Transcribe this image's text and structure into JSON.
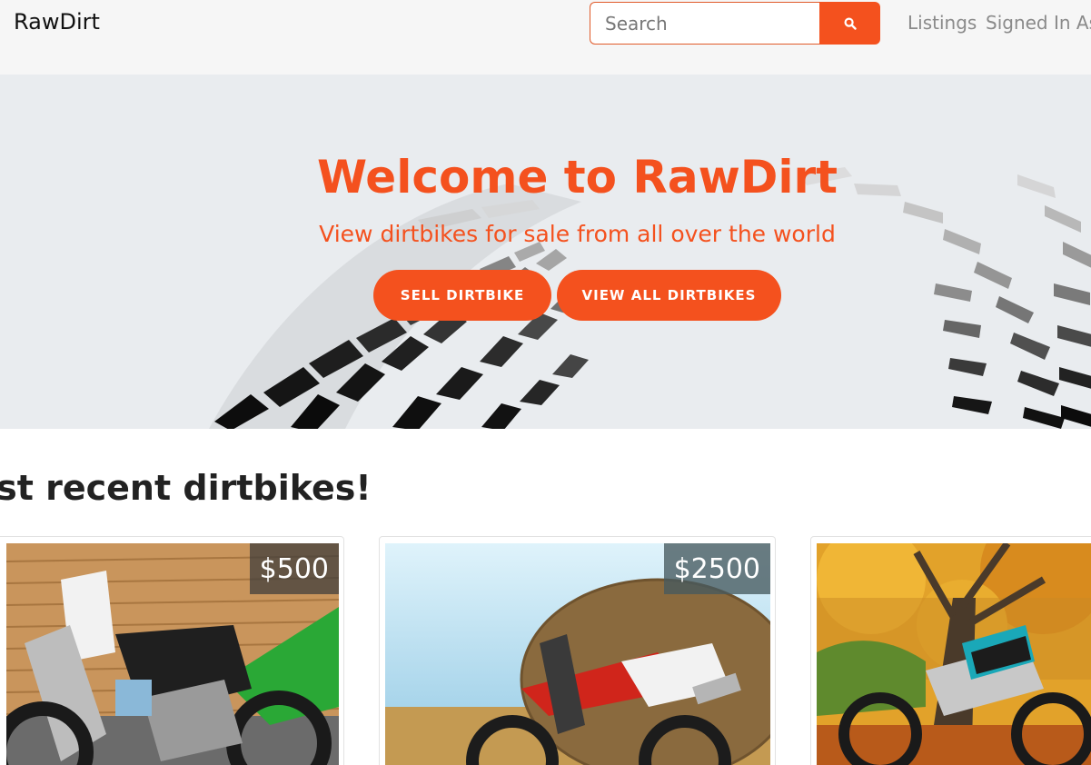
{
  "navbar": {
    "brand": "RawDirt",
    "search": {
      "placeholder": "Search",
      "value": ""
    },
    "search_icon": "search-icon",
    "links": [
      "Listings",
      "Signed In As"
    ]
  },
  "hero": {
    "title": "Welcome to RawDirt",
    "subtitle": "View dirtbikes for sale from all over the world",
    "buttons": {
      "sell": "SELL DIRTBIKE",
      "view_all": "VIEW ALL DIRTBIKES"
    }
  },
  "recent": {
    "title": "ost recent dirtbikes!",
    "cards": [
      {
        "price": "$500"
      },
      {
        "price": "$2500"
      },
      {
        "price": ""
      }
    ]
  },
  "colors": {
    "accent": "#f4511e",
    "navbar_bg": "#f6f6f6",
    "hero_bg": "#e9ecef"
  }
}
